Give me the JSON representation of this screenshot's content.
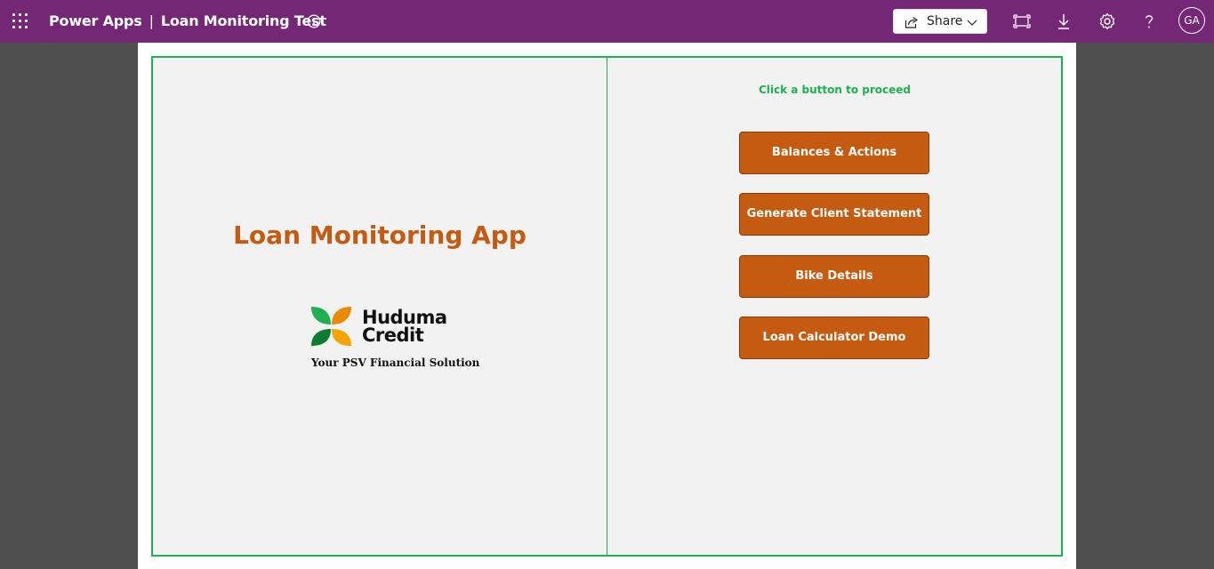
{
  "topbar": {
    "product": "Power Apps",
    "separator": "|",
    "app_name": "Loan Monitoring Test",
    "share_label": "Share",
    "avatar_initials": "GA",
    "bar_color": "#742774"
  },
  "main": {
    "title": "Loan Monitoring App",
    "logo_word_1": "Huduma",
    "logo_word_2": "Credit",
    "tagline": "Your PSV Financial Solution",
    "hint": "Click a button to proceed",
    "accent_color": "#c55a11",
    "frame_color": "#1fb052",
    "buttons": [
      {
        "label": "Balances & Actions"
      },
      {
        "label": "Generate Client Statement"
      },
      {
        "label": "Bike Details"
      },
      {
        "label": "Loan Calculator Demo"
      }
    ]
  }
}
